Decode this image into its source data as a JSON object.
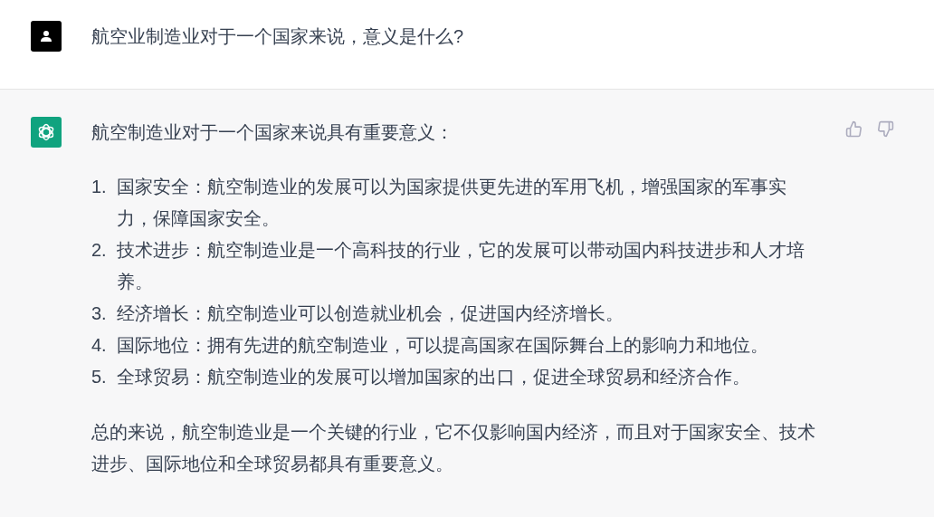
{
  "user_message": {
    "text": "航空业制造业对于一个国家来说，意义是什么?"
  },
  "assistant_message": {
    "intro": "航空制造业对于一个国家来说具有重要意义：",
    "list": [
      {
        "number": "1.",
        "text": "国家安全：航空制造业的发展可以为国家提供更先进的军用飞机，增强国家的军事实力，保障国家安全。"
      },
      {
        "number": "2.",
        "text": "技术进步：航空制造业是一个高科技的行业，它的发展可以带动国内科技进步和人才培养。"
      },
      {
        "number": "3.",
        "text": "经济增长：航空制造业可以创造就业机会，促进国内经济增长。"
      },
      {
        "number": "4.",
        "text": "国际地位：拥有先进的航空制造业，可以提高国家在国际舞台上的影响力和地位。"
      },
      {
        "number": "5.",
        "text": "全球贸易：航空制造业的发展可以增加国家的出口，促进全球贸易和经济合作。"
      }
    ],
    "conclusion": "总的来说，航空制造业是一个关键的行业，它不仅影响国内经济，而且对于国家安全、技术进步、国际地位和全球贸易都具有重要意义。"
  }
}
